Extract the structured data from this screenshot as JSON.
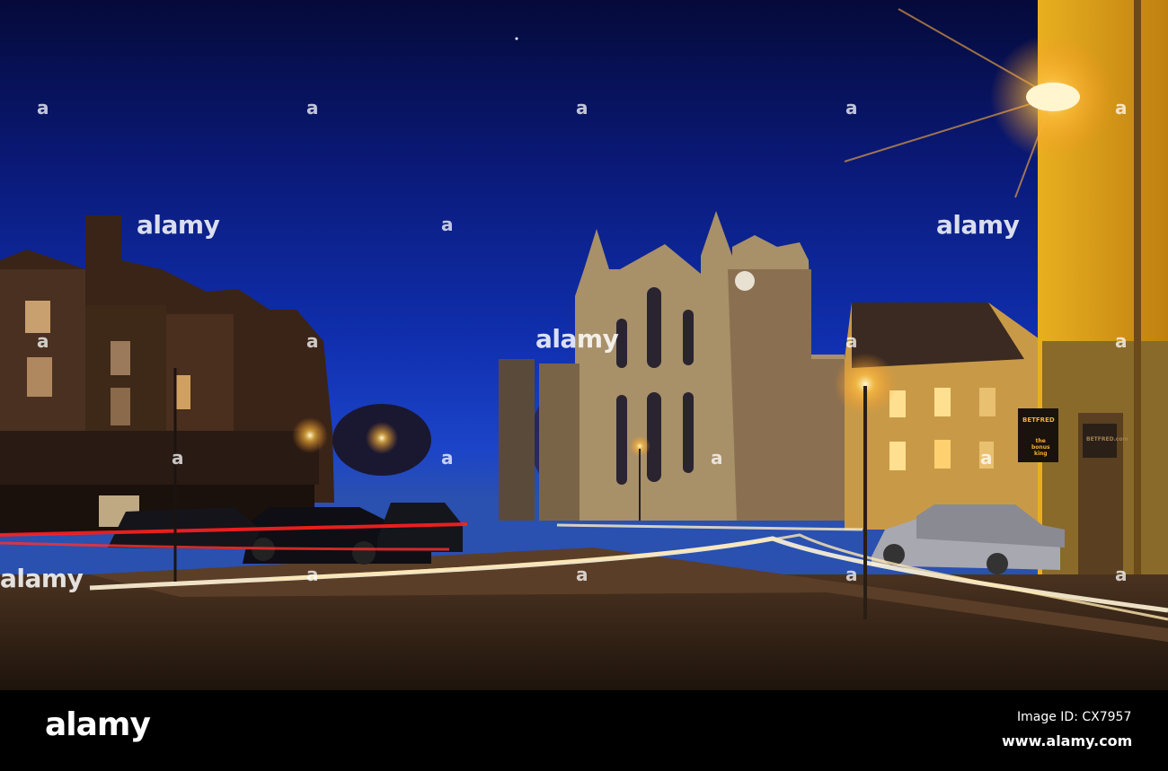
{
  "watermark": {
    "brand": "alamy",
    "letter": "a"
  },
  "signs": {
    "shop_name": "BETFRED",
    "slogan_1": "the",
    "slogan_2": "bonus",
    "slogan_3": "king",
    "window_text": "BETFRED.com"
  },
  "footer": {
    "logo": "alamy",
    "image_id": "Image ID: CX7957",
    "website": "www.alamy.com"
  },
  "colors": {
    "sky": "#0a1a7a",
    "lamp": "#ffd060",
    "stone": "#b8a070",
    "road": "#2a1e14"
  }
}
